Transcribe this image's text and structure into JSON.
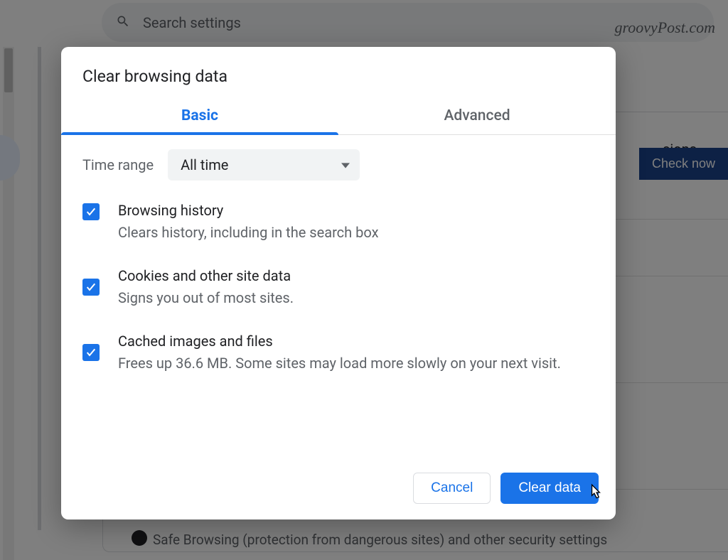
{
  "background": {
    "search_placeholder": "Search settings",
    "watermark": "groovyPost.com",
    "card_tail": "sions,",
    "check_button": "Check now",
    "safe_browsing": "Safe Browsing (protection from dangerous sites) and other security settings"
  },
  "dialog": {
    "title": "Clear browsing data",
    "tabs": {
      "basic": "Basic",
      "advanced": "Advanced"
    },
    "time_label": "Time range",
    "time_value": "All time",
    "options": [
      {
        "title": "Browsing history",
        "desc": "Clears history, including in the search box"
      },
      {
        "title": "Cookies and other site data",
        "desc": "Signs you out of most sites."
      },
      {
        "title": "Cached images and files",
        "desc": "Frees up 36.6 MB. Some sites may load more slowly on your next visit."
      }
    ],
    "cancel": "Cancel",
    "clear": "Clear data"
  }
}
